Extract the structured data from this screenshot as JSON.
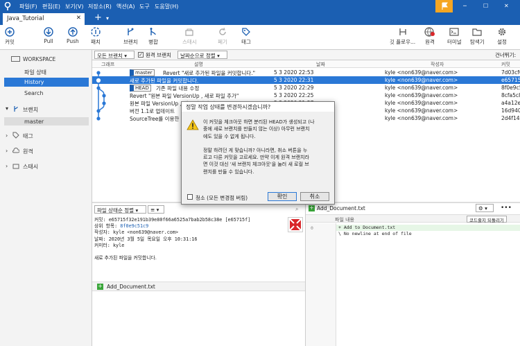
{
  "menu": [
    "파일(F)",
    "편집(E)",
    "보기(V)",
    "저장소(R)",
    "액션(A)",
    "도구",
    "도움말(H)"
  ],
  "tab": {
    "title": "Java_Tutorial",
    "add": "+"
  },
  "toolbar": {
    "commit": "커밋",
    "pull": "Pull",
    "push": "Push",
    "fetch": "패치",
    "branch": "브랜치",
    "merge": "병합",
    "stash": "스태시",
    "discard": "폐기",
    "tag": "태그",
    "gitflow": "깃 플로우...",
    "remote": "원격",
    "terminal": "터미널",
    "explorer": "탐색기",
    "settings": "설정"
  },
  "sidebar": {
    "workspace": "WORKSPACE",
    "file_status": "파일 상태",
    "history": "History",
    "search": "Search",
    "branches": "브랜치",
    "master": "master",
    "tags": "태그",
    "remotes": "원격",
    "stashes": "스태시"
  },
  "filter": {
    "all_branches": "모든 브랜치",
    "remote_branches": "원격 브랜치",
    "sort": "날짜순으로 정렬",
    "jump": "건너뛰기:"
  },
  "columns": {
    "graph": "그래프",
    "desc": "설명",
    "date": "날짜",
    "author": "작성자",
    "commit": "커밋"
  },
  "commits": [
    {
      "tag": "master",
      "desc": "Revert \"새로 추가된 파일을 커밋합니다.\"",
      "date": "5 3 2020 22:53",
      "author": "kyle <non639@naver.com>",
      "hash": "7d03cf6"
    },
    {
      "tag": "",
      "desc": "새로 추가된 파일을 커밋합니다.",
      "date": "5 3 2020 22:31",
      "author": "kyle <non639@naver.com>",
      "hash": "e65715f"
    },
    {
      "tag": "HEAD",
      "desc": "기존 파일 내용 수정",
      "date": "5 3 2020 22:29",
      "author": "kyle <non639@naver.com>",
      "hash": "8f0e9c5"
    },
    {
      "tag": "",
      "desc": "Revert \"원본 파일 VersionUp , 새로 파일 추가\"",
      "date": "5 3 2020 22:25",
      "author": "kyle <non639@naver.com>",
      "hash": "8cfa5c8"
    },
    {
      "tag": "",
      "desc": "원본 파일 VersionUp , 새로 파일 추가",
      "date": "5 3 2020 21:57",
      "author": "kyle <non639@naver.com>",
      "hash": "a4a12e7"
    },
    {
      "tag": "",
      "desc": "버전 1.1로 업데이트",
      "date": "",
      "author": "kyle <non639@naver.com>",
      "hash": "16d940e"
    },
    {
      "tag": "",
      "desc": "SourceTree를 이용한",
      "date": "",
      "author": "kyle <non639@naver.com>",
      "hash": "2d4f147"
    }
  ],
  "dialog": {
    "title": "정말 작업 상태를 변경하시겠습니까?",
    "msg1": "이 커밋을 체크아웃 하면 분리된 HEAD가 생성되고 (나",
    "msg2": "중에 새로 브랜치를 만들지 않는 이상) 아무런 브랜치",
    "msg3": "에도 있을 수 없게 됩니다.",
    "msg4": "정말 하려던 게 맞습니까? 아니라면, 취소 버튼을 누",
    "msg5": "르고 다른 커밋을 고르세요. 만약 이게 원격 브랜치라",
    "msg6": "면 이것 대신 '새 브랜치 체크아웃'을 눌러 새 로컬 브",
    "msg7": "랜치를 만들 수 있습니다.",
    "clean": "청소 (모든 변경점 버림)",
    "ok": "확인",
    "cancel": "취소"
  },
  "lower": {
    "sort": "파일 상태순 정렬",
    "commit_line": "커밋: e65715f32e191b39e80f66a6525a7bab2b58c38e [e65715f]",
    "parent_label": "상위 항목:",
    "parent": "8f0e9c51c9",
    "author_line": "작성자: kyle <non639@naver.com>",
    "date_line": "날짜: 2020년 3월 5일 목요일 오후 10:31:16",
    "committer_line": "커미터: kyle",
    "message": "새로 추가된 파일을 커밋합니다.",
    "file": "Add_Document.txt"
  },
  "diff": {
    "file": "Add_Document.txt",
    "content_label": "파일 내용",
    "revert": "코드줄지 되돌리기",
    "line_no": "0",
    "line1": "+ Add to Document.txt",
    "line2": "\\  No newline at end of file"
  },
  "colors": {
    "accent": "#1b5fb2",
    "selection": "#2a78d6",
    "graph": "#2a78d6"
  }
}
